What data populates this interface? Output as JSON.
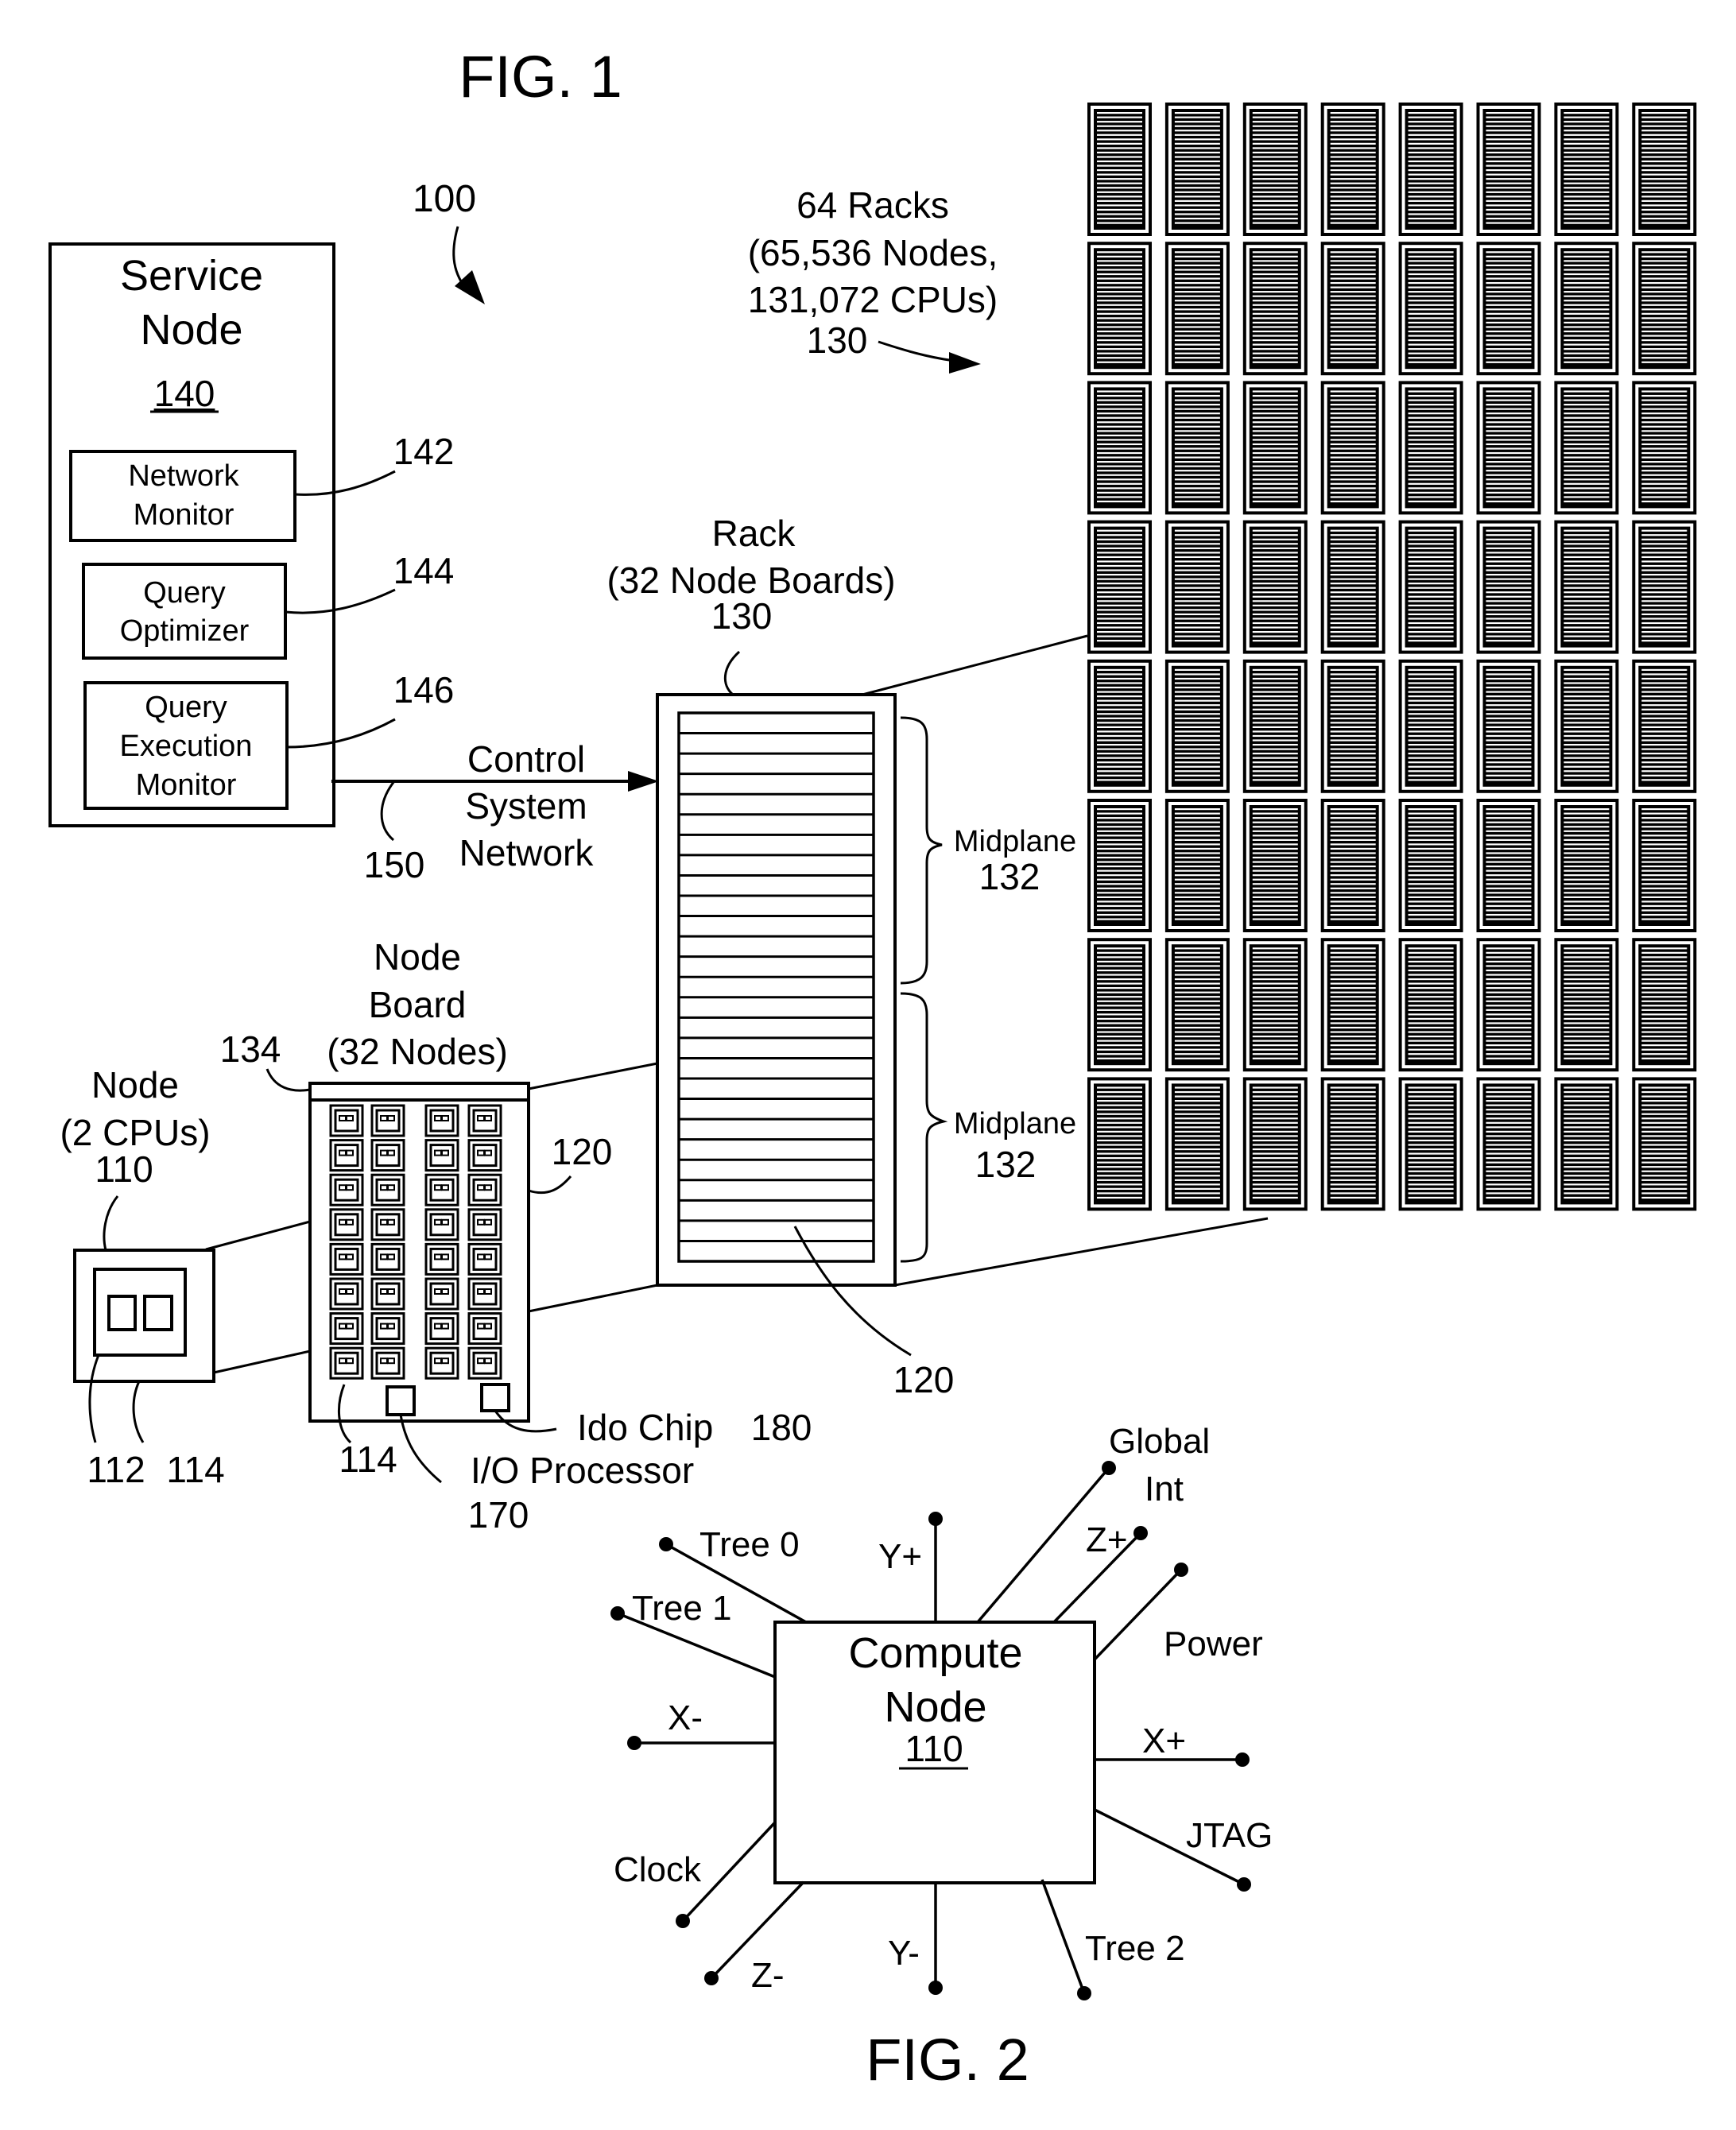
{
  "fig1": {
    "title": "FIG. 1",
    "system_ref": "100",
    "service_node": {
      "title_line1": "Service",
      "title_line2": "Node",
      "ref": "140",
      "modules": [
        {
          "line1": "Network",
          "line2": "Monitor",
          "line3": "",
          "ref": "142"
        },
        {
          "line1": "Query",
          "line2": "Optimizer",
          "line3": "",
          "ref": "144"
        },
        {
          "line1": "Query",
          "line2": "Execution",
          "line3": "Monitor",
          "ref": "146"
        }
      ]
    },
    "control_network": {
      "line1": "Control",
      "line2": "System",
      "line3": "Network",
      "ref": "150"
    },
    "racks_label": {
      "line1": "64 Racks",
      "line2": "(65,536 Nodes,",
      "line3": "131,072 CPUs)",
      "ref": "130"
    },
    "rack_grid": {
      "rows": 8,
      "cols": 8
    },
    "rack": {
      "line1": "Rack",
      "line2": "(32 Node Boards)",
      "ref": "130",
      "board_ref": "120",
      "node_board_count": 32,
      "midplanes": [
        {
          "label": "Midplane",
          "ref": "132"
        },
        {
          "label": "Midplane",
          "ref": "132"
        }
      ]
    },
    "node_board": {
      "line1": "Node",
      "line2": "Board",
      "line3": "(32 Nodes)",
      "ref": "120",
      "header_ref": "134",
      "node_ref": "114",
      "node_rows": 8,
      "node_cols": 4,
      "io_processor": {
        "label": "I/O Processor",
        "ref": "170"
      },
      "ido_chip": {
        "label": "Ido Chip",
        "ref": "180"
      }
    },
    "node": {
      "line1": "Node",
      "line2": "(2 CPUs)",
      "ref": "110",
      "cpu_ref": "112",
      "chip_ref": "114"
    }
  },
  "fig2": {
    "title": "FIG. 2",
    "compute_node": {
      "line1": "Compute",
      "line2": "Node",
      "ref": "110"
    },
    "pins": [
      {
        "name": "tree-0",
        "label": "Tree 0"
      },
      {
        "name": "tree-1",
        "label": "Tree 1"
      },
      {
        "name": "x-minus",
        "label": "X-"
      },
      {
        "name": "clock",
        "label": "Clock"
      },
      {
        "name": "z-minus",
        "label": "Z-"
      },
      {
        "name": "y-minus",
        "label": "Y-"
      },
      {
        "name": "tree-2",
        "label": "Tree 2"
      },
      {
        "name": "jtag",
        "label": "JTAG"
      },
      {
        "name": "x-plus",
        "label": "X+"
      },
      {
        "name": "power",
        "label": "Power"
      },
      {
        "name": "z-plus",
        "label": "Z+"
      },
      {
        "name": "global-int",
        "label": "Global",
        "label2": "Int"
      },
      {
        "name": "y-plus",
        "label": "Y+"
      }
    ]
  }
}
